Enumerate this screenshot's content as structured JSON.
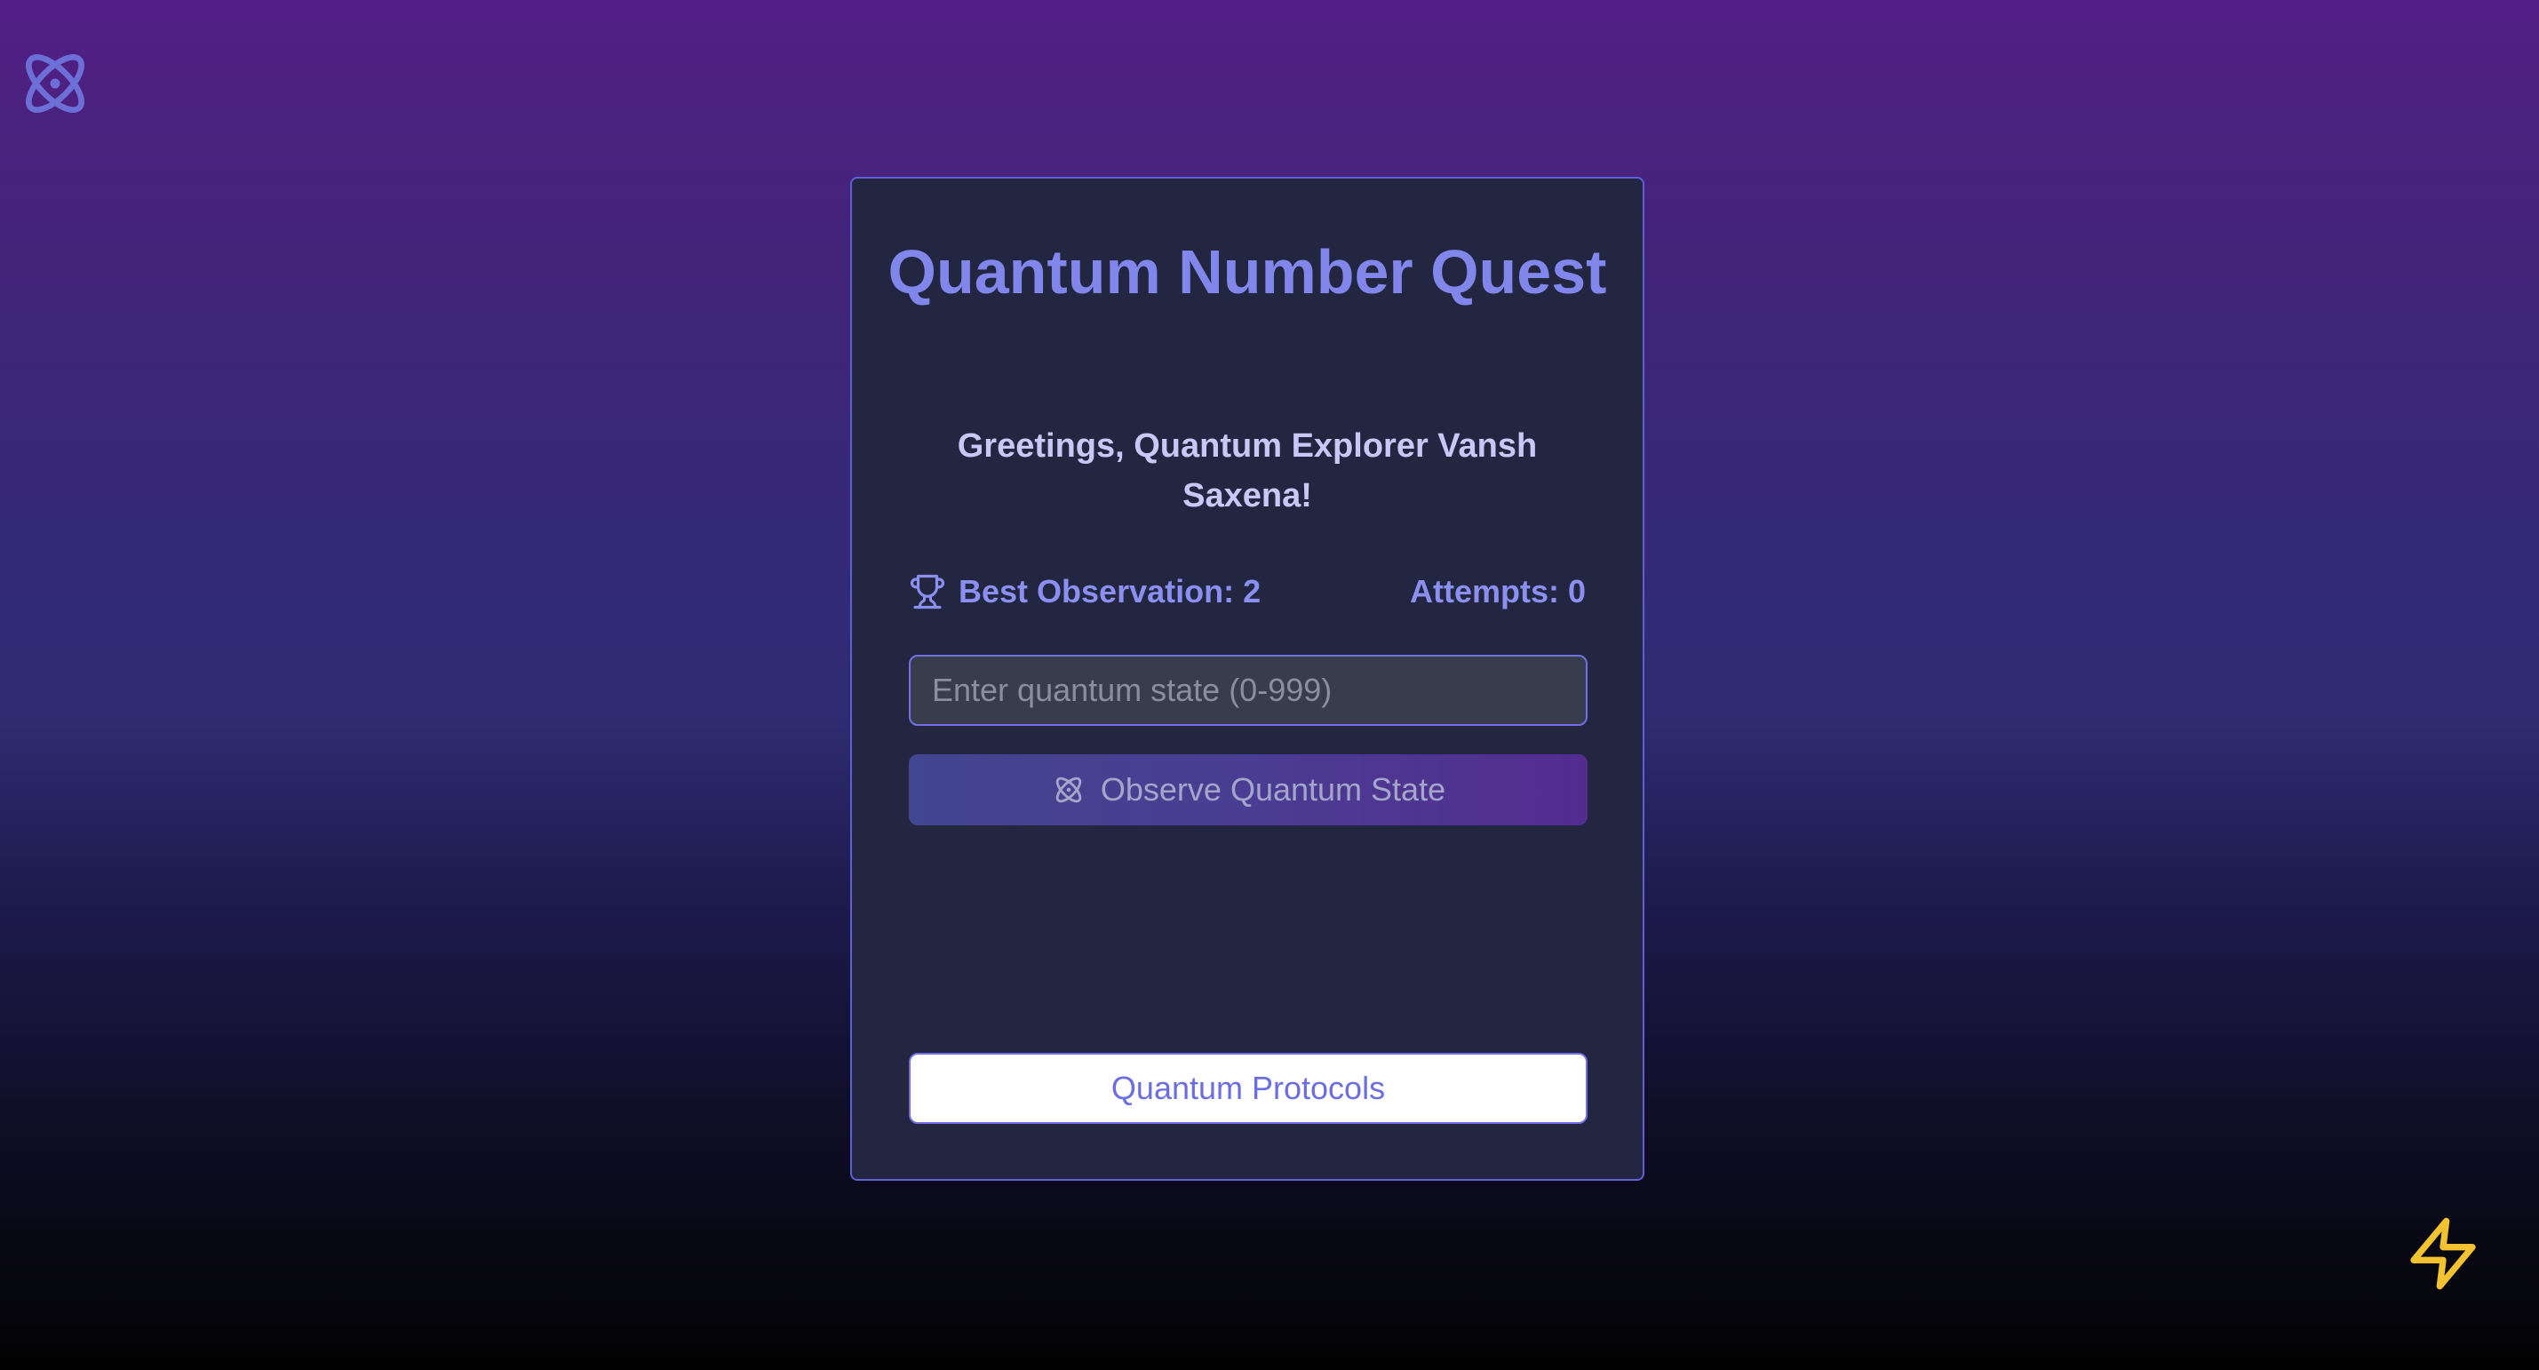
{
  "game": {
    "title": "Quantum Number Quest",
    "greeting": "Greetings, Quantum Explorer Vansh Saxena!",
    "best_label": "Best Observation: 2",
    "attempts_label": "Attempts: 0",
    "input_placeholder": "Enter quantum state (0-999)",
    "input_value": "",
    "observe_button": "Observe Quantum State",
    "protocols_button": "Quantum Protocols"
  },
  "icons": {
    "corner_top_left": "atom-icon",
    "corner_bottom_right": "lightning-bolt-icon",
    "stats": "trophy-icon",
    "observe_button": "atom-icon"
  },
  "colors": {
    "accent": "#8186ea",
    "card_background": "#232640",
    "card_border": "#5f5fd9",
    "bolt": "#f2c230"
  }
}
